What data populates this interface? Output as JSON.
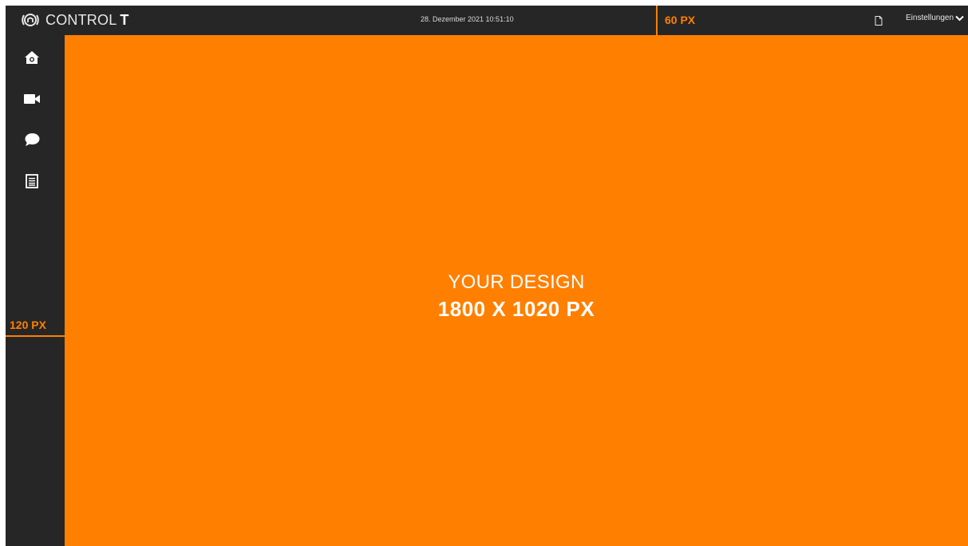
{
  "header": {
    "brand": "CONTROL",
    "brand_strong": "T",
    "datetime": "28. Dezember 2021 10:51:10",
    "height_label": "60 PX",
    "settings_label": "Einstellungen"
  },
  "sidebar": {
    "width_label": "120 PX",
    "items": [
      {
        "icon": "home-icon"
      },
      {
        "icon": "video-camera-icon"
      },
      {
        "icon": "chat-bubble-icon"
      },
      {
        "icon": "document-list-icon"
      }
    ]
  },
  "main": {
    "title": "YOUR DESIGN",
    "size": "1800 X 1020 PX"
  },
  "colors": {
    "accent": "#ff7f00",
    "chrome": "#262626",
    "text": "#ffffff"
  }
}
